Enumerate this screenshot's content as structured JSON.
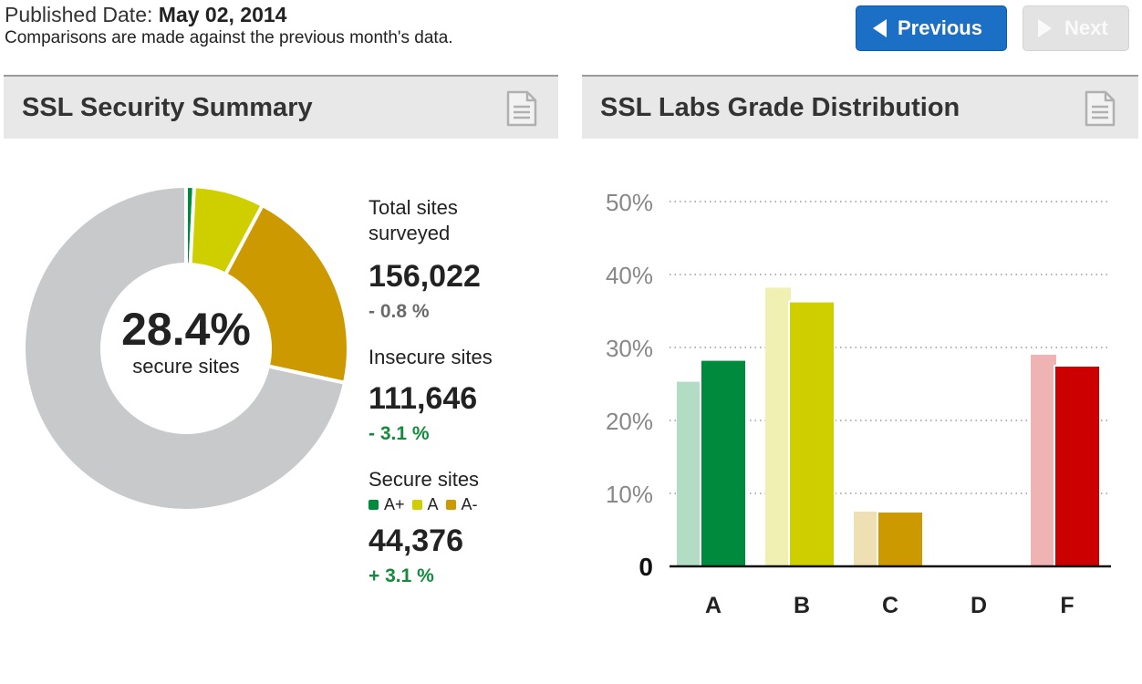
{
  "header": {
    "published_label": "Published Date:",
    "published_date": "May 02, 2014",
    "comparison_note": "Comparisons are made against the previous month's data.",
    "previous_label": "Previous",
    "next_label": "Next",
    "next_enabled": false
  },
  "summary_panel": {
    "title": "SSL Security Summary",
    "icon": "document-icon",
    "donut": {
      "center_value": "28.4%",
      "center_label": "secure sites",
      "segments": [
        {
          "name": "A+",
          "fraction": 0.008,
          "color": "#008a3e"
        },
        {
          "name": "A",
          "fraction": 0.07,
          "color": "#cfcf00"
        },
        {
          "name": "A-",
          "fraction": 0.206,
          "color": "#cc9900"
        },
        {
          "name": "Insecure",
          "fraction": 0.716,
          "color": "#c8c9cb"
        }
      ]
    },
    "stats": {
      "total_label": "Total sites surveyed",
      "total_value": "156,022",
      "total_change": "- 0.8 %",
      "insecure_label": "Insecure sites",
      "insecure_value": "111,646",
      "insecure_change": "- 3.1 %",
      "secure_label": "Secure sites",
      "secure_value": "44,376",
      "secure_change": "+ 3.1 %",
      "legend": [
        {
          "label": "A+",
          "color": "#008a3e"
        },
        {
          "label": "A",
          "color": "#cfcf00"
        },
        {
          "label": "A-",
          "color": "#cc9900"
        }
      ]
    }
  },
  "grade_panel": {
    "title": "SSL Labs Grade Distribution",
    "icon": "document-icon"
  },
  "chart_data": {
    "type": "bar",
    "categories": [
      "A",
      "B",
      "C",
      "D",
      "F"
    ],
    "series": [
      {
        "period": "previous",
        "values": [
          25.3,
          38.2,
          7.5,
          0,
          29.0
        ],
        "colors": [
          "#b3dcc4",
          "#f0f0b3",
          "#efe0b3",
          "#dddddd",
          "#efb3b3"
        ]
      },
      {
        "period": "current",
        "values": [
          28.3,
          36.3,
          7.5,
          0,
          27.5
        ],
        "colors": [
          "#008a3e",
          "#cfcf00",
          "#cc9900",
          "#999999",
          "#cc0000"
        ]
      }
    ],
    "ylim": [
      0,
      50
    ],
    "yticks": [
      0,
      10,
      20,
      30,
      40,
      50
    ],
    "ytick_labels": [
      "0",
      "10%",
      "20%",
      "30%",
      "40%",
      "50%"
    ],
    "grid": true
  }
}
